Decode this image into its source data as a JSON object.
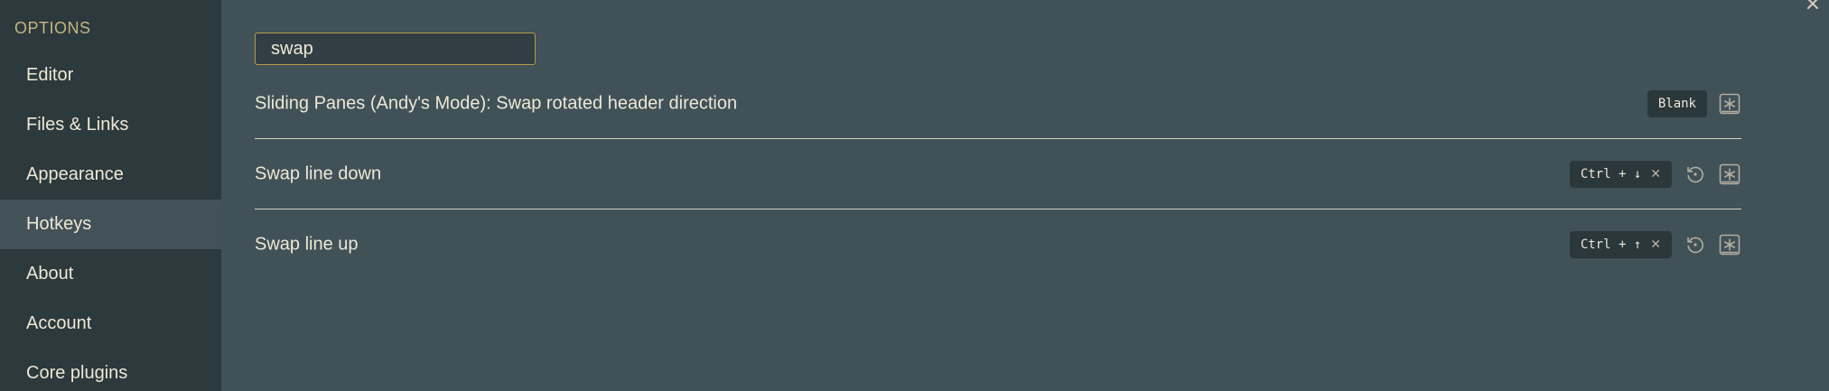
{
  "sidebar": {
    "heading": "OPTIONS",
    "items": [
      {
        "label": "Editor"
      },
      {
        "label": "Files & Links"
      },
      {
        "label": "Appearance"
      },
      {
        "label": "Hotkeys",
        "active": true
      },
      {
        "label": "About"
      },
      {
        "label": "Account"
      },
      {
        "label": "Core plugins"
      }
    ]
  },
  "search": {
    "value": "swap",
    "placeholder": ""
  },
  "hotkeys": [
    {
      "label": "Sliding Panes (Andy's Mode): Swap rotated header direction",
      "keys": [
        "Blank"
      ],
      "restorable": false
    },
    {
      "label": "Swap line down",
      "keys": [
        "Ctrl + ↓"
      ],
      "restorable": true
    },
    {
      "label": "Swap line up",
      "keys": [
        "Ctrl + ↑"
      ],
      "restorable": true
    }
  ],
  "icons": {
    "close": "close-icon",
    "restore": "restore-default-icon",
    "add": "add-hotkey-icon",
    "remove": "remove-hotkey-icon"
  },
  "colors": {
    "sidebar_bg": "#2c393d",
    "main_bg": "#405158",
    "accent": "#b69a4b",
    "heading": "#c5b680",
    "text": "#eee8d5"
  }
}
